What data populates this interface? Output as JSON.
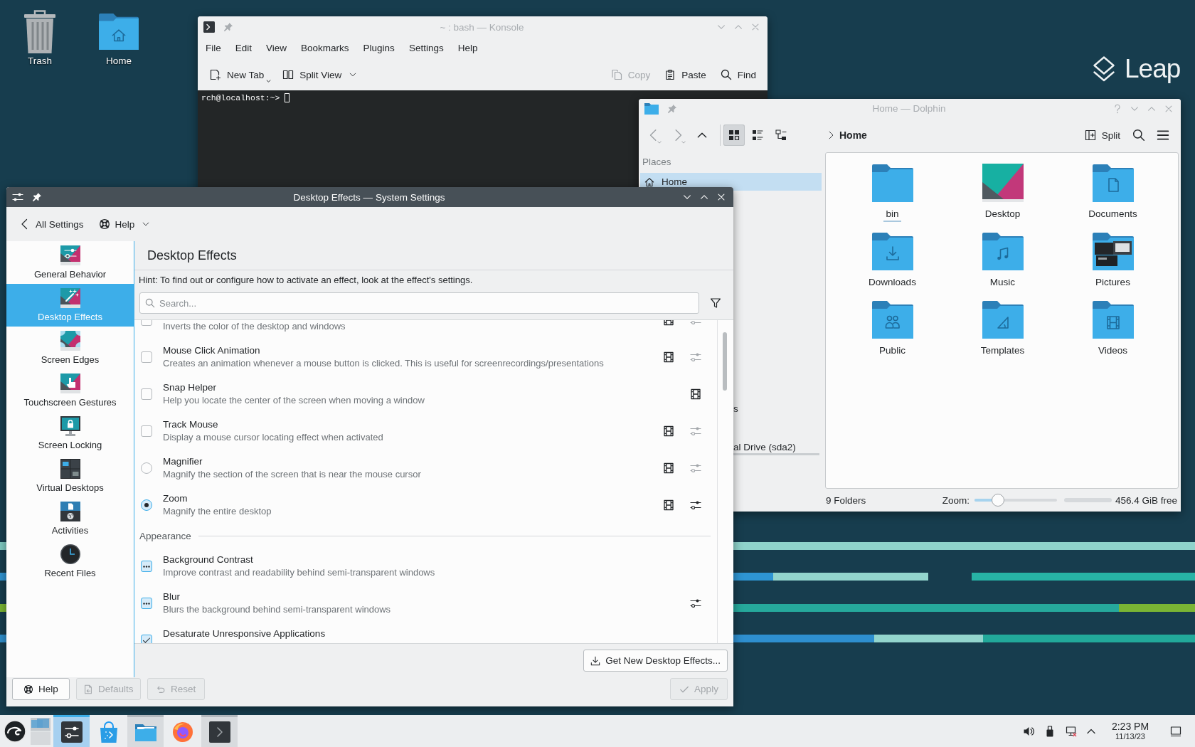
{
  "desktop": {
    "icons": [
      {
        "kind": "trash",
        "label": "Trash"
      },
      {
        "kind": "home",
        "label": "Home"
      }
    ],
    "logo": "Leap"
  },
  "konsole": {
    "active": false,
    "title": "~ : bash — Konsole",
    "menu": [
      "File",
      "Edit",
      "View",
      "Bookmarks",
      "Plugins",
      "Settings",
      "Help"
    ],
    "toolbar_left": [
      {
        "kind": "new-tab",
        "label": "New Tab",
        "disabled": false,
        "popup": true,
        "dropdown": false
      },
      {
        "kind": "split-view",
        "label": "Split View",
        "disabled": false,
        "popup": false,
        "dropdown": true
      }
    ],
    "toolbar_right": [
      {
        "kind": "copy",
        "label": "Copy",
        "disabled": true,
        "popup": false,
        "dropdown": false
      },
      {
        "kind": "paste",
        "label": "Paste",
        "disabled": false,
        "popup": false,
        "dropdown": false
      },
      {
        "kind": "find",
        "label": "Find",
        "disabled": false,
        "popup": false,
        "dropdown": false
      }
    ],
    "prompt": "rch@localhost:~>"
  },
  "dolphin": {
    "active": false,
    "title": "Home — Dolphin",
    "nav": [
      {
        "kind": "back",
        "disabled": true,
        "popup": true
      },
      {
        "kind": "forward",
        "disabled": true,
        "popup": true
      },
      {
        "kind": "up",
        "disabled": false,
        "popup": false
      }
    ],
    "view_modes": [
      {
        "kind": "icons",
        "selected": true
      },
      {
        "kind": "details",
        "selected": false
      },
      {
        "kind": "tree",
        "selected": false
      }
    ],
    "location": "Home",
    "split": "Split",
    "places": {
      "heading": "Places",
      "items": [
        {
          "kind": "home",
          "label": "Home",
          "selected": true
        }
      ],
      "fragments": [
        {
          "label": "s",
          "bar": false
        },
        {
          "label": "al Drive (sda2)",
          "bar": true
        }
      ]
    },
    "folders": [
      {
        "kind": "plain",
        "name": "bin",
        "focused": true
      },
      {
        "kind": "desktop",
        "name": "Desktop",
        "focused": false
      },
      {
        "kind": "documents",
        "name": "Documents",
        "focused": false
      },
      {
        "kind": "downloads",
        "name": "Downloads",
        "focused": false
      },
      {
        "kind": "music",
        "name": "Music",
        "focused": false
      },
      {
        "kind": "pictures",
        "name": "Pictures",
        "focused": false
      },
      {
        "kind": "public",
        "name": "Public",
        "focused": false
      },
      {
        "kind": "templates",
        "name": "Templates",
        "focused": false
      },
      {
        "kind": "videos",
        "name": "Videos",
        "focused": false
      }
    ],
    "status": {
      "count": "9 Folders",
      "zoom_label": "Zoom:",
      "zoom": {
        "level": 0.25
      },
      "free": "456.4 GiB free"
    }
  },
  "settings": {
    "active": true,
    "title": "Desktop Effects — System Settings",
    "back_label": "All Settings",
    "help_menu": "Help",
    "sidebar": [
      {
        "kind": "general",
        "label": "General Behavior",
        "selected": false
      },
      {
        "kind": "effects",
        "label": "Desktop Effects",
        "selected": true
      },
      {
        "kind": "edges",
        "label": "Screen Edges",
        "selected": false
      },
      {
        "kind": "touch",
        "label": "Touchscreen Gestures",
        "selected": false
      },
      {
        "kind": "locking",
        "label": "Screen Locking",
        "selected": false
      },
      {
        "kind": "desktops",
        "label": "Virtual Desktops",
        "selected": false
      },
      {
        "kind": "activities",
        "label": "Activities",
        "selected": false
      },
      {
        "kind": "recent",
        "label": "Recent Files",
        "selected": false
      }
    ],
    "page_title": "Desktop Effects",
    "hint": "Hint: To find out or configure how to activate an effect, look at the effect's settings.",
    "search": {
      "placeholder": "Search..."
    },
    "effect_groups": [
      {
        "effects": [
          {
            "kind": "checkbox",
            "clipped": true,
            "checked": false,
            "description": "Inverts the color of the desktop and windows",
            "video": true,
            "configure": true
          },
          {
            "kind": "checkbox",
            "clipped": false,
            "checked": false,
            "name": "Mouse Click Animation",
            "description": "Creates an animation whenever a mouse button is clicked. This is useful for screenrecordings/presentations",
            "video": true,
            "configure": true
          },
          {
            "kind": "checkbox",
            "clipped": false,
            "checked": false,
            "name": "Snap Helper",
            "description": "Help you locate the center of the screen when moving a window",
            "video": true,
            "configure": false
          },
          {
            "kind": "checkbox",
            "clipped": false,
            "checked": false,
            "name": "Track Mouse",
            "description": "Display a mouse cursor locating effect when activated",
            "video": true,
            "configure": true
          },
          {
            "kind": "radio",
            "clipped": false,
            "selected": false,
            "name": "Magnifier",
            "description": "Magnify the section of the screen that is near the mouse cursor",
            "video": true,
            "configure": true
          },
          {
            "kind": "radio",
            "clipped": false,
            "selected": true,
            "name": "Zoom",
            "description": "Magnify the entire desktop",
            "video": true,
            "configure": true
          }
        ]
      },
      {
        "heading": "Appearance",
        "effects": [
          {
            "kind": "auto",
            "clipped": false,
            "name": "Background Contrast",
            "description": "Improve contrast and readability behind semi-transparent windows",
            "video": false,
            "configure": false
          },
          {
            "kind": "auto",
            "clipped": false,
            "name": "Blur",
            "description": "Blurs the background behind semi-transparent windows",
            "video": false,
            "configure": true
          },
          {
            "kind": "checkbox",
            "clipped": false,
            "checked": true,
            "name": "Desaturate Unresponsive Applications",
            "video": false,
            "configure": false
          }
        ]
      }
    ],
    "get_new": "Get New Desktop Effects...",
    "buttons": [
      {
        "kind": "help",
        "label": "Help",
        "disabled": false
      },
      {
        "kind": "defaults",
        "label": "Defaults",
        "disabled": true
      },
      {
        "kind": "reset",
        "label": "Reset",
        "disabled": true
      }
    ],
    "apply": {
      "label": "Apply",
      "disabled": true
    }
  },
  "taskbar": {
    "tasks": [
      {
        "kind": "settings",
        "open": true,
        "active": true
      },
      {
        "kind": "discover",
        "open": false,
        "active": false
      },
      {
        "kind": "dolphin",
        "open": true,
        "active": false
      },
      {
        "kind": "firefox",
        "open": false,
        "active": false
      },
      {
        "kind": "konsole",
        "open": true,
        "active": false
      }
    ],
    "clock": {
      "time": "2:23 PM",
      "date": "11/13/23"
    }
  }
}
